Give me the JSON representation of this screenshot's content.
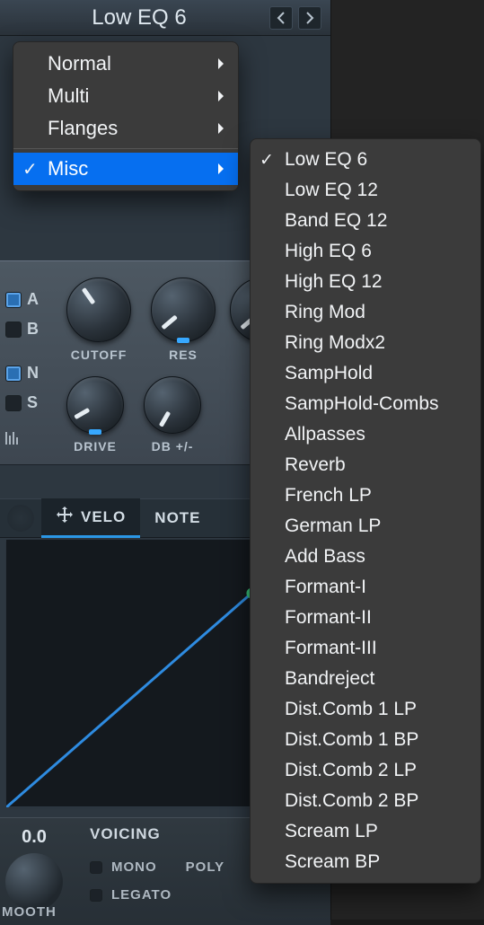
{
  "header": {
    "preset": "Low EQ 6"
  },
  "menu1": {
    "items": [
      {
        "label": "Normal",
        "has_sub": true,
        "checked": false,
        "selected": false
      },
      {
        "label": "Multi",
        "has_sub": true,
        "checked": false,
        "selected": false
      },
      {
        "label": "Flanges",
        "has_sub": true,
        "checked": false,
        "selected": false
      },
      {
        "label": "Misc",
        "has_sub": true,
        "checked": true,
        "selected": true
      }
    ]
  },
  "menu2": {
    "items": [
      {
        "label": "Low EQ 6",
        "checked": true
      },
      {
        "label": "Low EQ 12",
        "checked": false
      },
      {
        "label": "Band EQ 12",
        "checked": false
      },
      {
        "label": "High EQ 6",
        "checked": false
      },
      {
        "label": "High EQ 12",
        "checked": false
      },
      {
        "label": "Ring Mod",
        "checked": false
      },
      {
        "label": "Ring Modx2",
        "checked": false
      },
      {
        "label": "SampHold",
        "checked": false
      },
      {
        "label": "SampHold-Combs",
        "checked": false
      },
      {
        "label": "Allpasses",
        "checked": false
      },
      {
        "label": "Reverb",
        "checked": false
      },
      {
        "label": "French LP",
        "checked": false
      },
      {
        "label": "German LP",
        "checked": false
      },
      {
        "label": "Add Bass",
        "checked": false
      },
      {
        "label": "Formant-I",
        "checked": false
      },
      {
        "label": "Formant-II",
        "checked": false
      },
      {
        "label": "Formant-III",
        "checked": false
      },
      {
        "label": "Bandreject",
        "checked": false
      },
      {
        "label": "Dist.Comb 1 LP",
        "checked": false
      },
      {
        "label": "Dist.Comb 1 BP",
        "checked": false
      },
      {
        "label": "Dist.Comb 2 LP",
        "checked": false
      },
      {
        "label": "Dist.Comb 2 BP",
        "checked": false
      },
      {
        "label": "Scream LP",
        "checked": false
      },
      {
        "label": "Scream BP",
        "checked": false
      }
    ]
  },
  "toggles": {
    "a": {
      "label": "A",
      "on": true
    },
    "b": {
      "label": "B",
      "on": false
    },
    "n": {
      "label": "N",
      "on": true
    },
    "s": {
      "label": "S",
      "on": false
    }
  },
  "knobs": {
    "cutoff": "CUTOFF",
    "res": "RES",
    "drive": "DRIVE",
    "db": "DB +/-"
  },
  "tabs": {
    "velo": "VELO",
    "note": "NOTE"
  },
  "bottom": {
    "pitch_value": "0.0",
    "smooth": "MOOTH",
    "voicing_header": "VOICING",
    "mono": "MONO",
    "poly": "POLY",
    "legato": "LEGATO"
  }
}
